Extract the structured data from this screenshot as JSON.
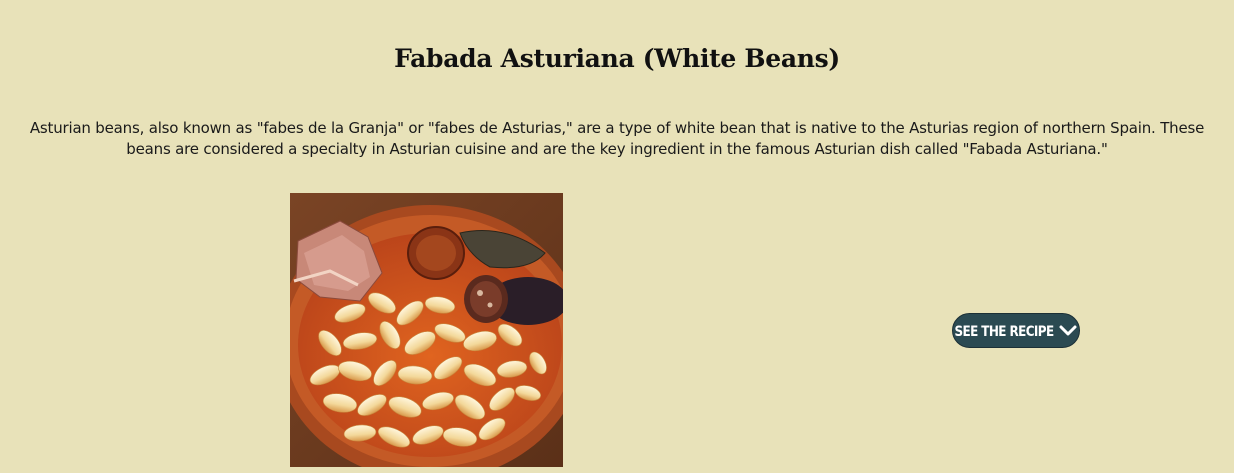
{
  "recipe": {
    "title": "Fabada Asturiana (White Beans)",
    "description": "Asturian beans, also known as \"fabes de la Granja\" or \"fabes de Asturias,\" are a type of white bean that is native to the Asturias region of northern Spain. These beans are considered a specialty in Asturian cuisine and are the key ingredient in the famous Asturian dish called \"Fabada Asturiana.\"",
    "see_recipe_label": "SEE THE RECIPE",
    "button_icon": "chevron-down-icon"
  },
  "colors": {
    "background": "#e8e2b9",
    "button": "#2b4a52",
    "button_text": "#ffffff"
  }
}
